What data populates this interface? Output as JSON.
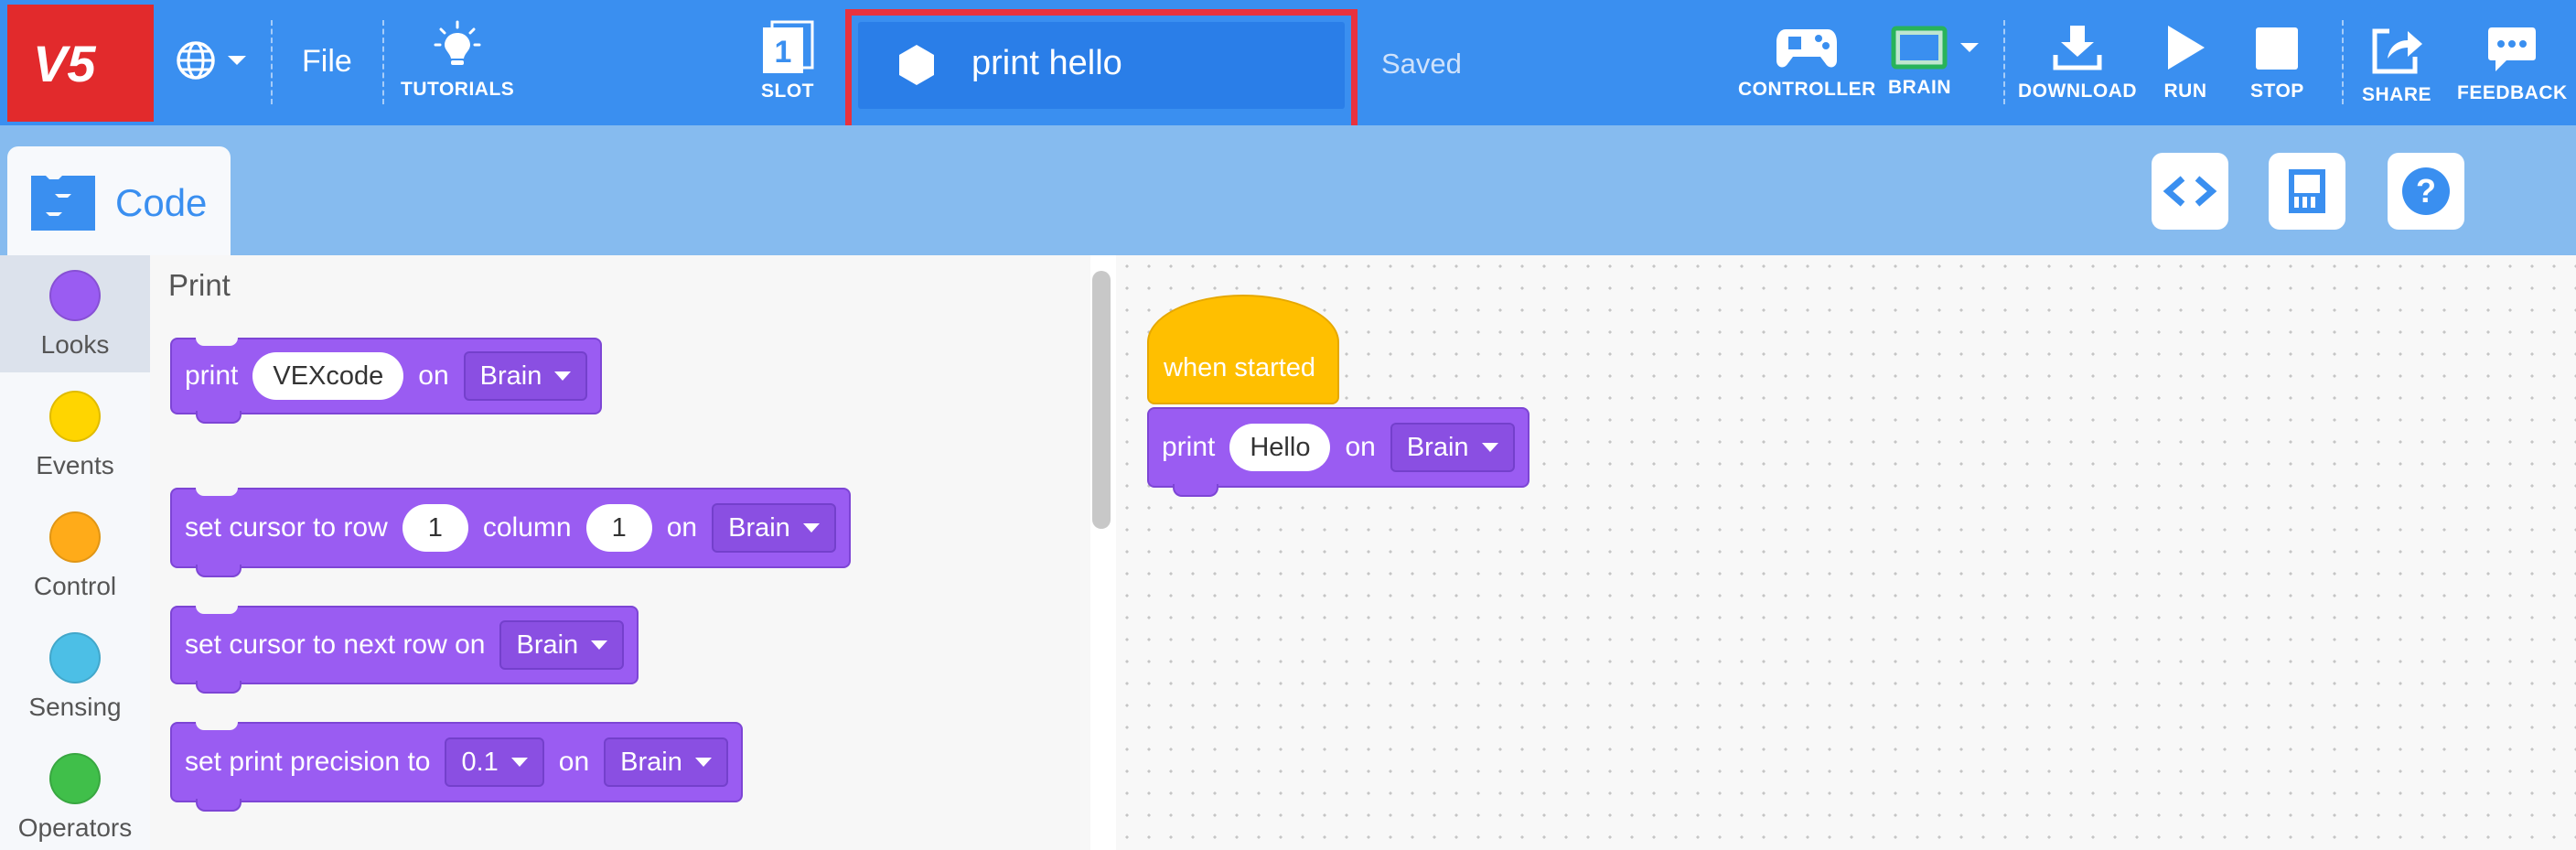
{
  "toolbar": {
    "logo_text": "V5",
    "file_label": "File",
    "tutorials_label": "TUTORIALS",
    "slot_label": "SLOT",
    "slot_number": "1",
    "project_name": "print hello",
    "save_status": "Saved",
    "controller_label": "CONTROLLER",
    "brain_label": "BRAIN",
    "download_label": "DOWNLOAD",
    "run_label": "RUN",
    "stop_label": "STOP",
    "share_label": "SHARE",
    "feedback_label": "FEEDBACK"
  },
  "tabs": {
    "code_label": "Code"
  },
  "categories": [
    {
      "label": "Looks",
      "color": "#9a5cf2"
    },
    {
      "label": "Events",
      "color": "#ffd500"
    },
    {
      "label": "Control",
      "color": "#ffab19"
    },
    {
      "label": "Sensing",
      "color": "#4cbfe6"
    },
    {
      "label": "Operators",
      "color": "#40bf4a"
    }
  ],
  "palette": {
    "section_title": "Print",
    "blocks": {
      "print": {
        "word1": "print",
        "value": "VEXcode",
        "word2": "on",
        "device": "Brain"
      },
      "set_cursor": {
        "word1": "set cursor to row",
        "row": "1",
        "word2": "column",
        "column": "1",
        "word3": "on",
        "device": "Brain"
      },
      "next_row": {
        "word1": "set cursor to next row on",
        "device": "Brain"
      },
      "precision": {
        "word1": "set print precision to",
        "value": "0.1",
        "word2": "on",
        "device": "Brain"
      }
    }
  },
  "workspace": {
    "hat_label": "when started",
    "print_block": {
      "word1": "print",
      "value": "Hello",
      "word2": "on",
      "device": "Brain"
    }
  },
  "colors": {
    "toolbar": "#3a8ff0",
    "logo": "#e22a2c",
    "highlight": "#e8323e",
    "looks_block": "#9a5cf2",
    "events_block": "#ffbf00"
  }
}
